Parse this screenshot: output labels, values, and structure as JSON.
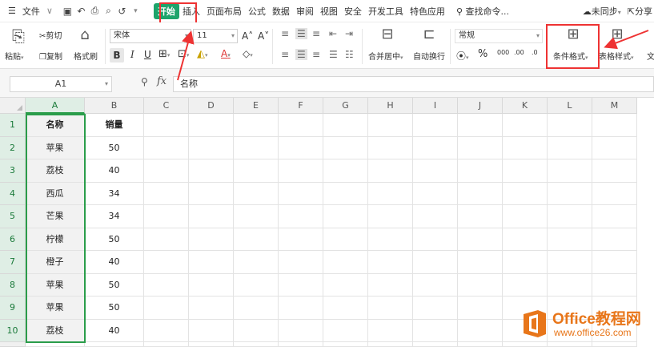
{
  "menubar": {
    "hamburger": "☰",
    "file": "文件",
    "file_chevron": "∨",
    "quick_access": [
      "▣",
      "↶",
      "⎙",
      "⌕",
      "↺",
      "▾"
    ],
    "tabs": [
      "开始",
      "插入",
      "页面布局",
      "公式",
      "数据",
      "审阅",
      "视图",
      "安全",
      "开发工具",
      "特色应用"
    ],
    "active_tab": "开始",
    "search": "查找命令...",
    "sync": "未同步",
    "share": "分享"
  },
  "ribbon": {
    "paste": "粘贴",
    "cut": "剪切",
    "copy": "复制",
    "format_painter": "格式刷",
    "font_name": "宋体",
    "font_size": "11",
    "bold": "B",
    "italic": "I",
    "underline": "U",
    "grow_font": "A˄",
    "shrink_font": "A˅",
    "merge_center": "合并居中",
    "wrap_text": "自动换行",
    "number_format": "常规",
    "percent": "%",
    "thousands": "000",
    "inc_decimal": ".00",
    "dec_decimal": ".0",
    "conditional_format": "条件格式",
    "table_style": "表格样式"
  },
  "formula_bar": {
    "cell_ref": "A1",
    "fx": "fx",
    "content": "名称"
  },
  "sheet": {
    "columns": [
      "A",
      "B",
      "C",
      "D",
      "E",
      "F",
      "G",
      "H",
      "I",
      "J",
      "K",
      "L",
      "M"
    ],
    "rows": [
      "1",
      "2",
      "3",
      "4",
      "5",
      "6",
      "7",
      "8",
      "9",
      "10"
    ],
    "header": [
      "名称",
      "销量"
    ],
    "data": [
      [
        "苹果",
        "50"
      ],
      [
        "荔枝",
        "40"
      ],
      [
        "西瓜",
        "34"
      ],
      [
        "芒果",
        "34"
      ],
      [
        "柠檬",
        "50"
      ],
      [
        "橙子",
        "40"
      ],
      [
        "苹果",
        "50"
      ],
      [
        "苹果",
        "50"
      ],
      [
        "荔枝",
        "40"
      ]
    ],
    "selected_column": "A"
  },
  "watermark": {
    "title": "Office教程网",
    "url": "www.office26.com"
  },
  "colors": {
    "accent_green": "#1ea46b",
    "selection_green": "#2a9d4a",
    "highlight_red": "#e33333",
    "watermark_orange": "#e8761a"
  }
}
